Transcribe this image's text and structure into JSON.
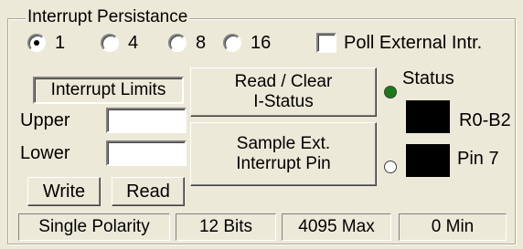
{
  "group_title": "Interrupt Persistance",
  "persistence_options": [
    {
      "label": "1",
      "checked": true
    },
    {
      "label": "4",
      "checked": false
    },
    {
      "label": "8",
      "checked": false
    },
    {
      "label": "16",
      "checked": false
    }
  ],
  "poll_external": {
    "label": "Poll External Intr.",
    "checked": false
  },
  "limits": {
    "header": "Interrupt Limits",
    "upper_label": "Upper",
    "upper_value": "",
    "lower_label": "Lower",
    "lower_value": "",
    "write_label": "Write",
    "read_label": "Read"
  },
  "buttons": {
    "read_clear": "Read / Clear\nI-Status",
    "sample_ext": "Sample  Ext.\nInterrupt Pin"
  },
  "status": {
    "label": "Status",
    "led_color": "#1a7a1a",
    "reg_label": "R0-B2",
    "pin_label": "Pin 7",
    "pin_led_color": "#ffffff"
  },
  "footer": {
    "polarity": "Single Polarity",
    "bits": "12 Bits",
    "max": "4095 Max",
    "min": "0 Min"
  }
}
